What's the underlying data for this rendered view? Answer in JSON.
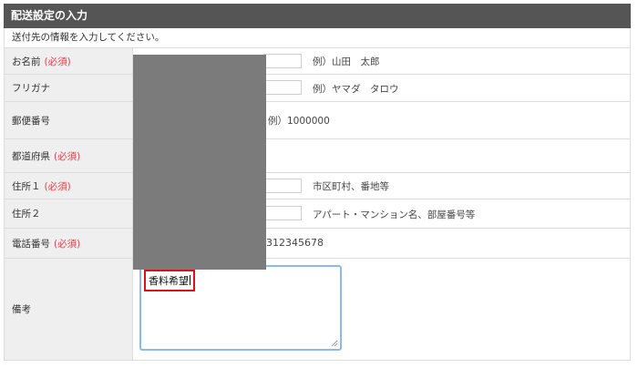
{
  "header": {
    "title": "配送設定の入力"
  },
  "intro": "送付先の情報を入力してください。",
  "required_mark": "(必須)",
  "fields": {
    "name": {
      "label": "お名前",
      "hint": "例）山田　太郎"
    },
    "kana": {
      "label": "フリガナ",
      "hint": "例）ヤマダ　タロウ"
    },
    "zip": {
      "label": "郵便番号",
      "hint": "例）1000000"
    },
    "pref": {
      "label": "都道府県"
    },
    "addr1": {
      "label": "住所１",
      "hint": "市区町村、番地等"
    },
    "addr2": {
      "label": "住所２",
      "hint": "アパート・マンション名、部屋番号等"
    },
    "tel": {
      "label": "電話番号",
      "value_visible": "312345678"
    },
    "memo": {
      "label": "備考",
      "value": "香料希望"
    }
  },
  "colors": {
    "header_bg": "#555555",
    "required": "#e0414c",
    "focus_border": "#8ab8ef",
    "highlight": "#d8141a"
  }
}
